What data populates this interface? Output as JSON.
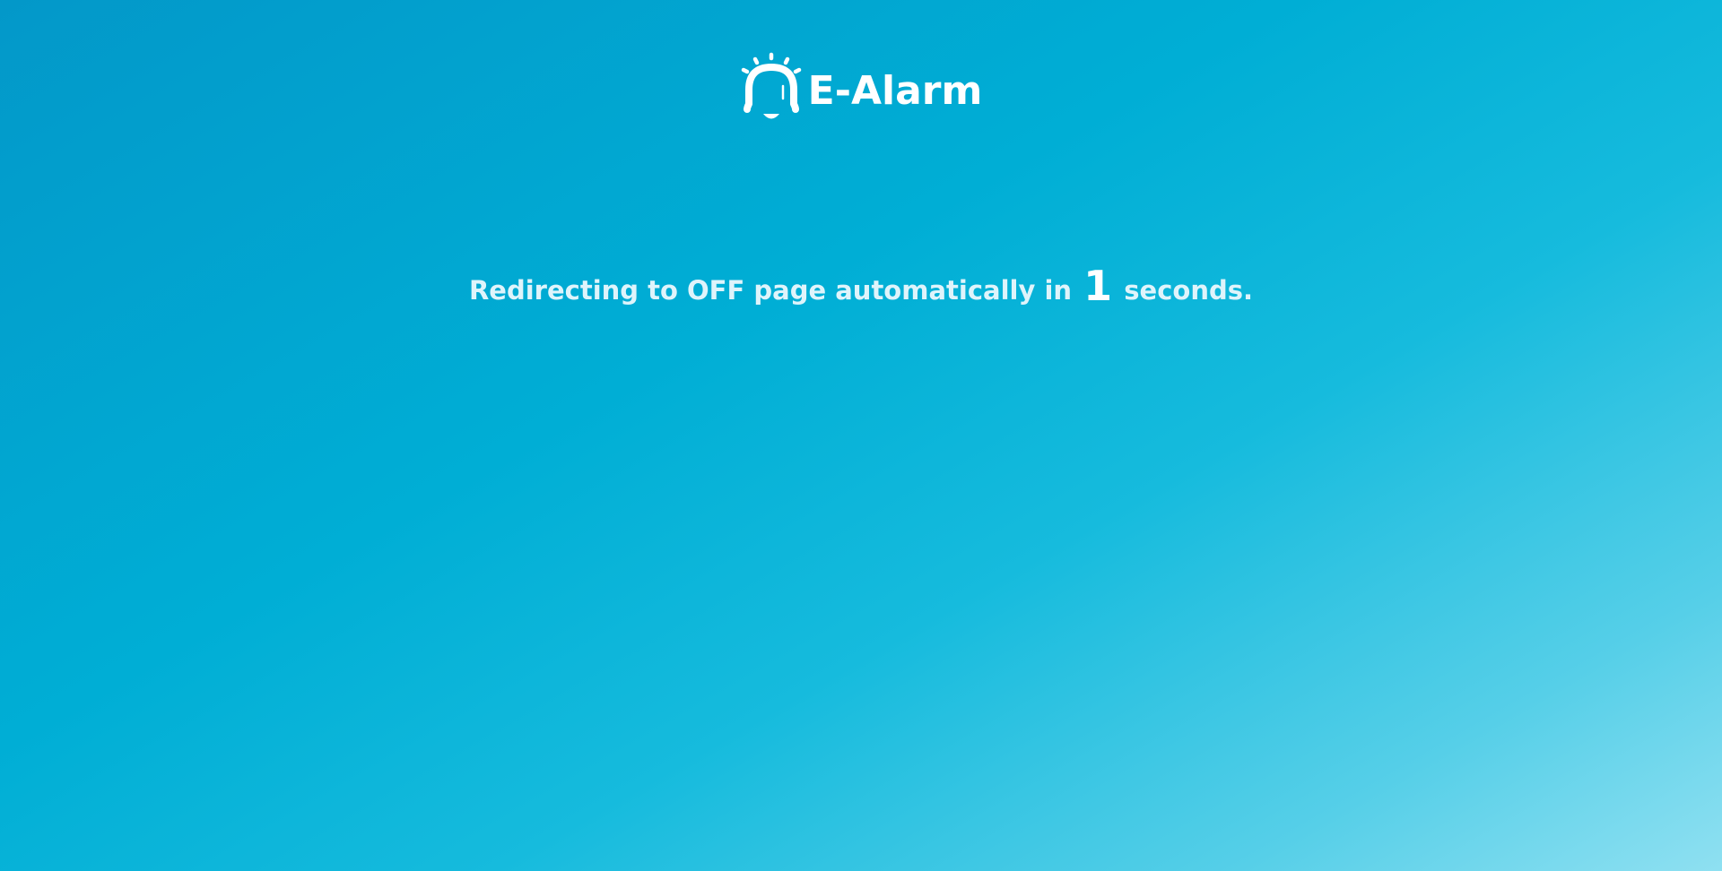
{
  "brand": {
    "name": "E-Alarm",
    "icon": "bell-icon",
    "color": "#ffffff"
  },
  "redirect": {
    "prefix": "Redirecting to OFF page automatically in",
    "countdown": "1",
    "suffix": "seconds."
  },
  "theme": {
    "gradient_start": "#0398c9",
    "gradient_mid": "#00aed5",
    "gradient_end": "#8fe0f1",
    "text_color": "#dff4fb"
  }
}
